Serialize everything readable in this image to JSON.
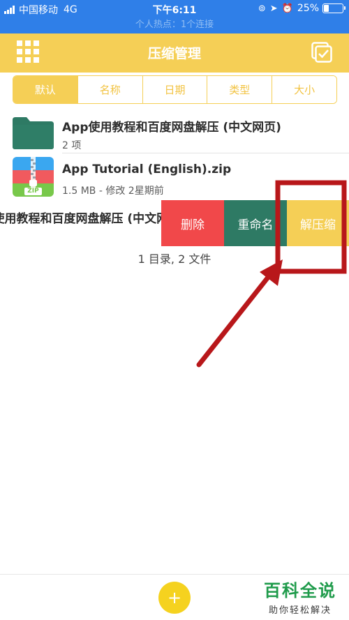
{
  "status": {
    "carrier": "中国移动",
    "network": "4G",
    "time": "下午6:11",
    "battery": "25%",
    "battery_fraction": 0.25,
    "icons": [
      "lock-rotation-icon",
      "location-arrow-icon",
      "alarm-icon"
    ]
  },
  "connection_banner": "个人热点：1个连接",
  "navbar": {
    "title": "压缩管理",
    "left_icon": "grid-menu-icon",
    "right_icon": "multi-select-icon"
  },
  "sort_tabs": [
    {
      "label": "默认",
      "active": true
    },
    {
      "label": "名称",
      "active": false
    },
    {
      "label": "日期",
      "active": false
    },
    {
      "label": "类型",
      "active": false
    },
    {
      "label": "大小",
      "active": false
    }
  ],
  "files": [
    {
      "title": "App使用教程和百度网盘解压 (中文网页)",
      "subtitle": "2 项",
      "icon": "folder-icon"
    },
    {
      "title": "App Tutorial (English).zip",
      "subtitle": "1.5 MB - 修改 2星期前",
      "icon": "zip-file-icon"
    },
    {
      "title": "App使用教程和百度网盘解压 (中文网页).zip",
      "icon": "zip-file-icon"
    }
  ],
  "swipe_actions": {
    "delete": "删除",
    "rename": "重命名",
    "extract": "解压缩"
  },
  "zip_badge": "ZIP",
  "summary": "1 目录, 2 文件",
  "fab_label": "+",
  "watermark": {
    "title": "百科全说",
    "subtitle": "助你轻松解决"
  },
  "colors": {
    "status_bar": "#2f7fe8",
    "accent_yellow": "#f5cf56",
    "delete_red": "#f1484a",
    "rename_green": "#2e7a64",
    "folder_green": "#2e7a64",
    "annotation_red": "#b8171a",
    "watermark_green": "#1f9b4b"
  }
}
